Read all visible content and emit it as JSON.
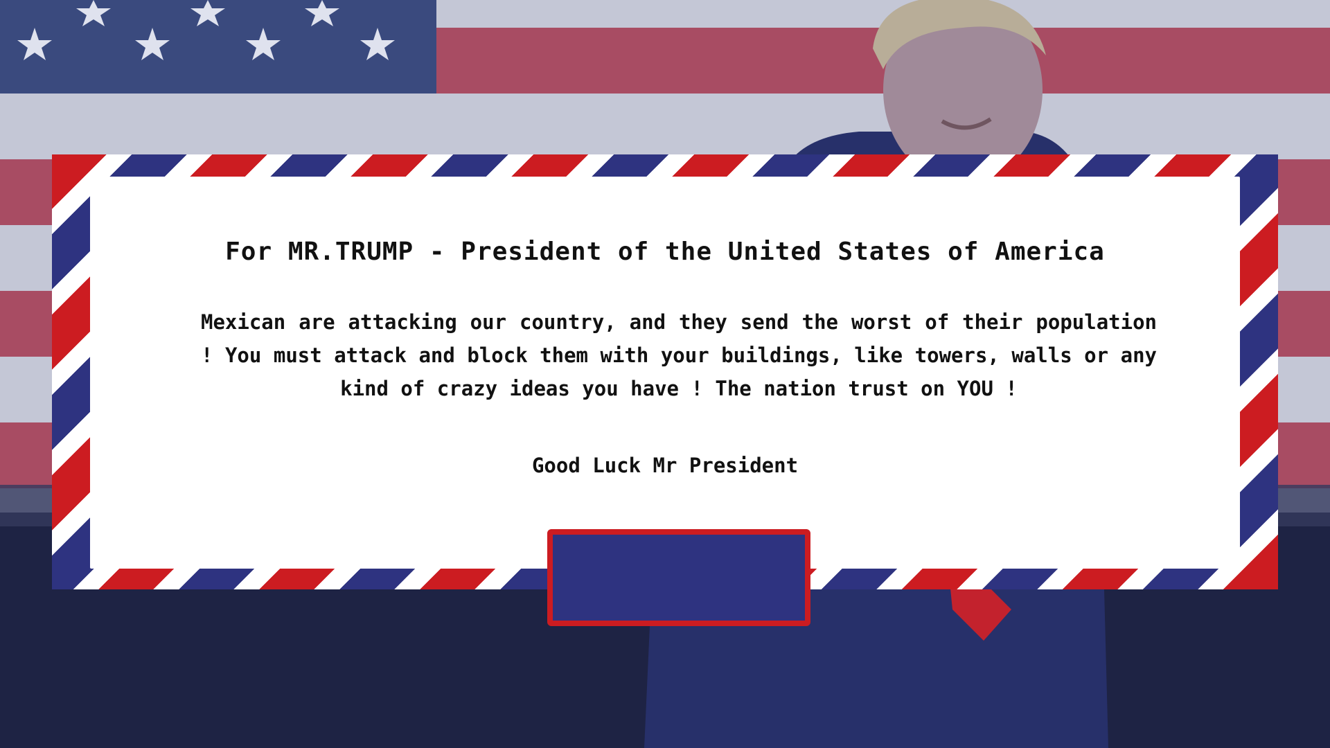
{
  "letter": {
    "title": "For MR.TRUMP - President of the United States of America",
    "body": "Mexican are attacking our country, and they send the worst of their population ! You must attack and block them with your buildings, like towers, walls or any kind of crazy ideas you have ! The nation trust on YOU !",
    "signoff": "Good Luck Mr President"
  },
  "button": {
    "label": ""
  },
  "colors": {
    "red": "#cc1c21",
    "blue": "#2e3380",
    "paper": "#ffffff",
    "text": "#111111",
    "overlay": "#1e2a5a"
  }
}
